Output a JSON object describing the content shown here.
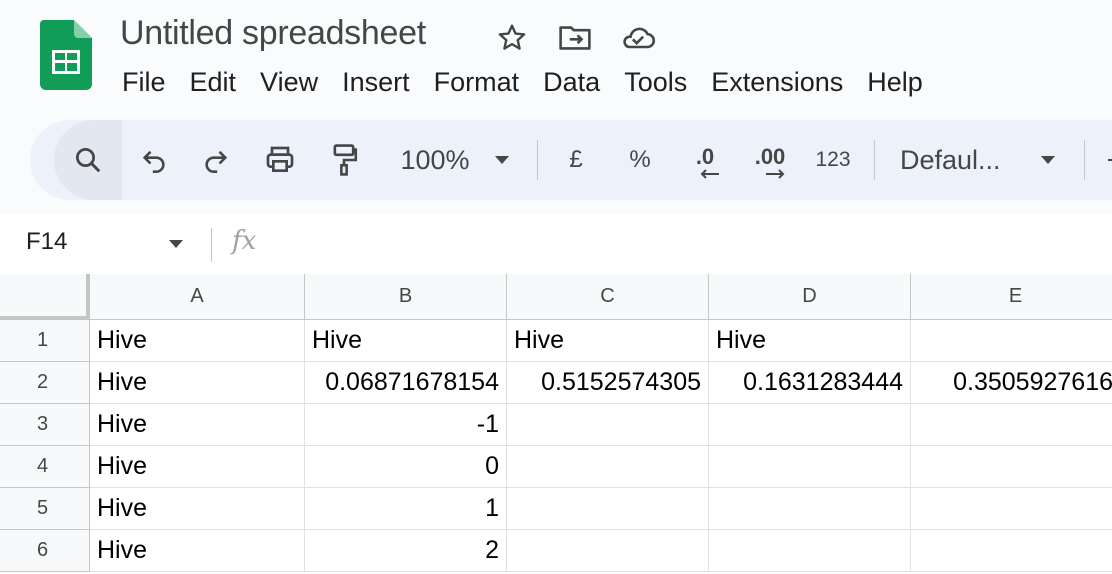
{
  "app": {
    "title": "Untitled spreadsheet",
    "brand_color": "#0f9d58"
  },
  "title_icons": [
    "star-icon",
    "move-to-folder-icon",
    "cloud-saved-icon"
  ],
  "menu": [
    "File",
    "Edit",
    "View",
    "Insert",
    "Format",
    "Data",
    "Tools",
    "Extensions",
    "Help"
  ],
  "toolbar": {
    "zoom": "100%",
    "currency": "£",
    "percent": "%",
    "decrease_decimal": ".0",
    "increase_decimal": ".00",
    "more_formats": "123",
    "font": "Defaul..."
  },
  "formula_bar": {
    "cell_ref": "F14",
    "fx_label": "fx",
    "value": ""
  },
  "grid": {
    "columns": [
      "A",
      "B",
      "C",
      "D",
      "E"
    ],
    "rows": [
      {
        "num": "1",
        "cells": [
          {
            "v": "Hive",
            "t": "text"
          },
          {
            "v": "Hive",
            "t": "text"
          },
          {
            "v": "Hive",
            "t": "text"
          },
          {
            "v": "Hive",
            "t": "text"
          },
          {
            "v": "",
            "t": "text"
          }
        ]
      },
      {
        "num": "2",
        "cells": [
          {
            "v": "Hive",
            "t": "text"
          },
          {
            "v": "0.06871678154",
            "t": "num"
          },
          {
            "v": "0.5152574305",
            "t": "num"
          },
          {
            "v": "0.1631283444",
            "t": "num"
          },
          {
            "v": "0.3505927616",
            "t": "num"
          }
        ]
      },
      {
        "num": "3",
        "cells": [
          {
            "v": "Hive",
            "t": "text"
          },
          {
            "v": "-1",
            "t": "num"
          },
          {
            "v": "",
            "t": "text"
          },
          {
            "v": "",
            "t": "text"
          },
          {
            "v": "",
            "t": "text"
          }
        ]
      },
      {
        "num": "4",
        "cells": [
          {
            "v": "Hive",
            "t": "text"
          },
          {
            "v": "0",
            "t": "num"
          },
          {
            "v": "",
            "t": "text"
          },
          {
            "v": "",
            "t": "text"
          },
          {
            "v": "",
            "t": "text"
          }
        ]
      },
      {
        "num": "5",
        "cells": [
          {
            "v": "Hive",
            "t": "text"
          },
          {
            "v": "1",
            "t": "num"
          },
          {
            "v": "",
            "t": "text"
          },
          {
            "v": "",
            "t": "text"
          },
          {
            "v": "",
            "t": "text"
          }
        ]
      },
      {
        "num": "6",
        "cells": [
          {
            "v": "Hive",
            "t": "text"
          },
          {
            "v": "2",
            "t": "num"
          },
          {
            "v": "",
            "t": "text"
          },
          {
            "v": "",
            "t": "text"
          },
          {
            "v": "",
            "t": "text"
          }
        ]
      }
    ]
  }
}
